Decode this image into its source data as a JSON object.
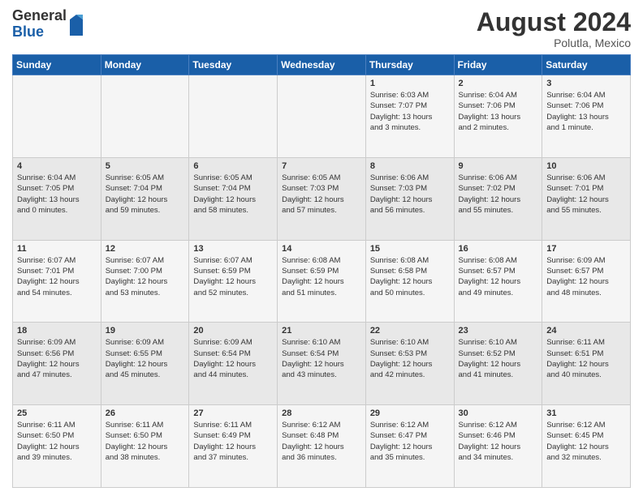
{
  "header": {
    "logo_general": "General",
    "logo_blue": "Blue",
    "month_title": "August 2024",
    "location": "Polutla, Mexico"
  },
  "days_of_week": [
    "Sunday",
    "Monday",
    "Tuesday",
    "Wednesday",
    "Thursday",
    "Friday",
    "Saturday"
  ],
  "weeks": [
    [
      {
        "day": "",
        "info": ""
      },
      {
        "day": "",
        "info": ""
      },
      {
        "day": "",
        "info": ""
      },
      {
        "day": "",
        "info": ""
      },
      {
        "day": "1",
        "info": "Sunrise: 6:03 AM\nSunset: 7:07 PM\nDaylight: 13 hours\nand 3 minutes."
      },
      {
        "day": "2",
        "info": "Sunrise: 6:04 AM\nSunset: 7:06 PM\nDaylight: 13 hours\nand 2 minutes."
      },
      {
        "day": "3",
        "info": "Sunrise: 6:04 AM\nSunset: 7:06 PM\nDaylight: 13 hours\nand 1 minute."
      }
    ],
    [
      {
        "day": "4",
        "info": "Sunrise: 6:04 AM\nSunset: 7:05 PM\nDaylight: 13 hours\nand 0 minutes."
      },
      {
        "day": "5",
        "info": "Sunrise: 6:05 AM\nSunset: 7:04 PM\nDaylight: 12 hours\nand 59 minutes."
      },
      {
        "day": "6",
        "info": "Sunrise: 6:05 AM\nSunset: 7:04 PM\nDaylight: 12 hours\nand 58 minutes."
      },
      {
        "day": "7",
        "info": "Sunrise: 6:05 AM\nSunset: 7:03 PM\nDaylight: 12 hours\nand 57 minutes."
      },
      {
        "day": "8",
        "info": "Sunrise: 6:06 AM\nSunset: 7:03 PM\nDaylight: 12 hours\nand 56 minutes."
      },
      {
        "day": "9",
        "info": "Sunrise: 6:06 AM\nSunset: 7:02 PM\nDaylight: 12 hours\nand 55 minutes."
      },
      {
        "day": "10",
        "info": "Sunrise: 6:06 AM\nSunset: 7:01 PM\nDaylight: 12 hours\nand 55 minutes."
      }
    ],
    [
      {
        "day": "11",
        "info": "Sunrise: 6:07 AM\nSunset: 7:01 PM\nDaylight: 12 hours\nand 54 minutes."
      },
      {
        "day": "12",
        "info": "Sunrise: 6:07 AM\nSunset: 7:00 PM\nDaylight: 12 hours\nand 53 minutes."
      },
      {
        "day": "13",
        "info": "Sunrise: 6:07 AM\nSunset: 6:59 PM\nDaylight: 12 hours\nand 52 minutes."
      },
      {
        "day": "14",
        "info": "Sunrise: 6:08 AM\nSunset: 6:59 PM\nDaylight: 12 hours\nand 51 minutes."
      },
      {
        "day": "15",
        "info": "Sunrise: 6:08 AM\nSunset: 6:58 PM\nDaylight: 12 hours\nand 50 minutes."
      },
      {
        "day": "16",
        "info": "Sunrise: 6:08 AM\nSunset: 6:57 PM\nDaylight: 12 hours\nand 49 minutes."
      },
      {
        "day": "17",
        "info": "Sunrise: 6:09 AM\nSunset: 6:57 PM\nDaylight: 12 hours\nand 48 minutes."
      }
    ],
    [
      {
        "day": "18",
        "info": "Sunrise: 6:09 AM\nSunset: 6:56 PM\nDaylight: 12 hours\nand 47 minutes."
      },
      {
        "day": "19",
        "info": "Sunrise: 6:09 AM\nSunset: 6:55 PM\nDaylight: 12 hours\nand 45 minutes."
      },
      {
        "day": "20",
        "info": "Sunrise: 6:09 AM\nSunset: 6:54 PM\nDaylight: 12 hours\nand 44 minutes."
      },
      {
        "day": "21",
        "info": "Sunrise: 6:10 AM\nSunset: 6:54 PM\nDaylight: 12 hours\nand 43 minutes."
      },
      {
        "day": "22",
        "info": "Sunrise: 6:10 AM\nSunset: 6:53 PM\nDaylight: 12 hours\nand 42 minutes."
      },
      {
        "day": "23",
        "info": "Sunrise: 6:10 AM\nSunset: 6:52 PM\nDaylight: 12 hours\nand 41 minutes."
      },
      {
        "day": "24",
        "info": "Sunrise: 6:11 AM\nSunset: 6:51 PM\nDaylight: 12 hours\nand 40 minutes."
      }
    ],
    [
      {
        "day": "25",
        "info": "Sunrise: 6:11 AM\nSunset: 6:50 PM\nDaylight: 12 hours\nand 39 minutes."
      },
      {
        "day": "26",
        "info": "Sunrise: 6:11 AM\nSunset: 6:50 PM\nDaylight: 12 hours\nand 38 minutes."
      },
      {
        "day": "27",
        "info": "Sunrise: 6:11 AM\nSunset: 6:49 PM\nDaylight: 12 hours\nand 37 minutes."
      },
      {
        "day": "28",
        "info": "Sunrise: 6:12 AM\nSunset: 6:48 PM\nDaylight: 12 hours\nand 36 minutes."
      },
      {
        "day": "29",
        "info": "Sunrise: 6:12 AM\nSunset: 6:47 PM\nDaylight: 12 hours\nand 35 minutes."
      },
      {
        "day": "30",
        "info": "Sunrise: 6:12 AM\nSunset: 6:46 PM\nDaylight: 12 hours\nand 34 minutes."
      },
      {
        "day": "31",
        "info": "Sunrise: 6:12 AM\nSunset: 6:45 PM\nDaylight: 12 hours\nand 32 minutes."
      }
    ]
  ]
}
